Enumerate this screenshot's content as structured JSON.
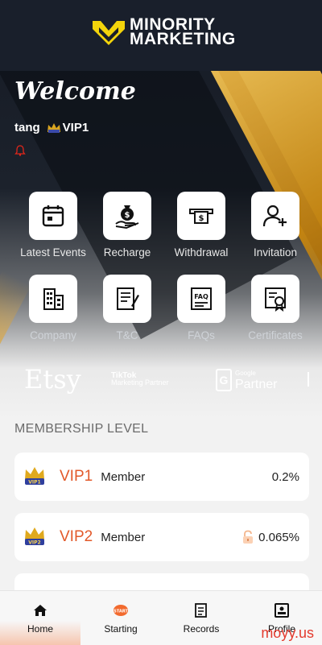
{
  "brand": {
    "line1": "MINORITY",
    "line2": "MARKETING",
    "accent_color": "#f3d40b"
  },
  "welcome": {
    "title": "Welcome",
    "username": "tang",
    "vip_level": "VIP1"
  },
  "grid": [
    {
      "label": "Latest Events",
      "icon": "calendar-icon"
    },
    {
      "label": "Recharge",
      "icon": "money-bag-hand-icon"
    },
    {
      "label": "Withdrawal",
      "icon": "cash-withdraw-icon"
    },
    {
      "label": "Invitation",
      "icon": "add-user-icon"
    },
    {
      "label": "Company",
      "icon": "building-icon"
    },
    {
      "label": "T&C",
      "icon": "document-pen-icon"
    },
    {
      "label": "FAQs",
      "icon": "faq-document-icon"
    },
    {
      "label": "Certificates",
      "icon": "certificate-icon"
    }
  ],
  "partners": {
    "etsy": "Etsy",
    "tiktok_line1": "TikTok",
    "tiktok_line2": "Marketing Partner",
    "google_line1": "Google",
    "google_line2": "Partner"
  },
  "membership": {
    "title": "MEMBERSHIP LEVEL",
    "levels": [
      {
        "name": "VIP1",
        "type": "Member",
        "rate": "0.2%",
        "locked": false
      },
      {
        "name": "VIP2",
        "type": "Member",
        "rate": "0.065%",
        "locked": true
      }
    ]
  },
  "nav": [
    {
      "label": "Home",
      "icon": "home-icon",
      "active": true
    },
    {
      "label": "Starting",
      "icon": "start-badge-icon",
      "active": false
    },
    {
      "label": "Records",
      "icon": "records-icon",
      "active": false
    },
    {
      "label": "Profile",
      "icon": "profile-card-icon",
      "active": false
    }
  ],
  "watermark": "moyy.us",
  "colors": {
    "vip_name": "#e2592a",
    "dark_bg": "#191f2b",
    "gold": "#e0a22c"
  }
}
